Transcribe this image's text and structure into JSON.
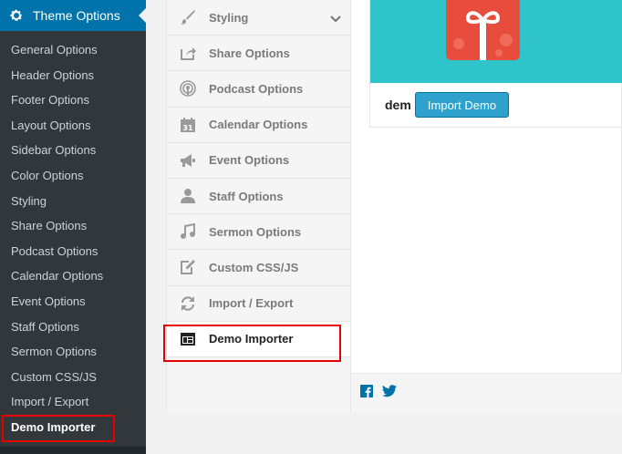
{
  "sidebar": {
    "head_title": "Theme Options",
    "items": [
      {
        "label": "General Options"
      },
      {
        "label": "Header Options"
      },
      {
        "label": "Footer Options"
      },
      {
        "label": "Layout Options"
      },
      {
        "label": "Sidebar Options"
      },
      {
        "label": "Color Options"
      },
      {
        "label": "Styling"
      },
      {
        "label": "Share Options"
      },
      {
        "label": "Podcast Options"
      },
      {
        "label": "Calendar Options"
      },
      {
        "label": "Event Options"
      },
      {
        "label": "Staff Options"
      },
      {
        "label": "Sermon Options"
      },
      {
        "label": "Custom CSS/JS"
      },
      {
        "label": "Import / Export"
      },
      {
        "label": "Demo Importer"
      }
    ],
    "current": "Demo Importer"
  },
  "options_menu": {
    "items": [
      {
        "label": "Styling",
        "icon": "brush-icon"
      },
      {
        "label": "Share Options",
        "icon": "share-icon"
      },
      {
        "label": "Podcast Options",
        "icon": "podcast-icon"
      },
      {
        "label": "Calendar Options",
        "icon": "calendar-icon"
      },
      {
        "label": "Event Options",
        "icon": "megaphone-icon"
      },
      {
        "label": "Staff Options",
        "icon": "person-icon"
      },
      {
        "label": "Sermon Options",
        "icon": "music-icon"
      },
      {
        "label": "Custom CSS/JS",
        "icon": "edit-icon"
      },
      {
        "label": "Import / Export",
        "icon": "refresh-icon"
      },
      {
        "label": "Demo Importer",
        "icon": "layout-icon"
      }
    ],
    "active": "Demo Importer",
    "calendar_icon_day": "31"
  },
  "demo": {
    "name": "dem",
    "import_button": "Import Demo"
  },
  "colors": {
    "accent": "#0073aa",
    "button": "#2ea2cc",
    "highlight": "#e60000",
    "thumb_bg": "#2ec4c9"
  }
}
